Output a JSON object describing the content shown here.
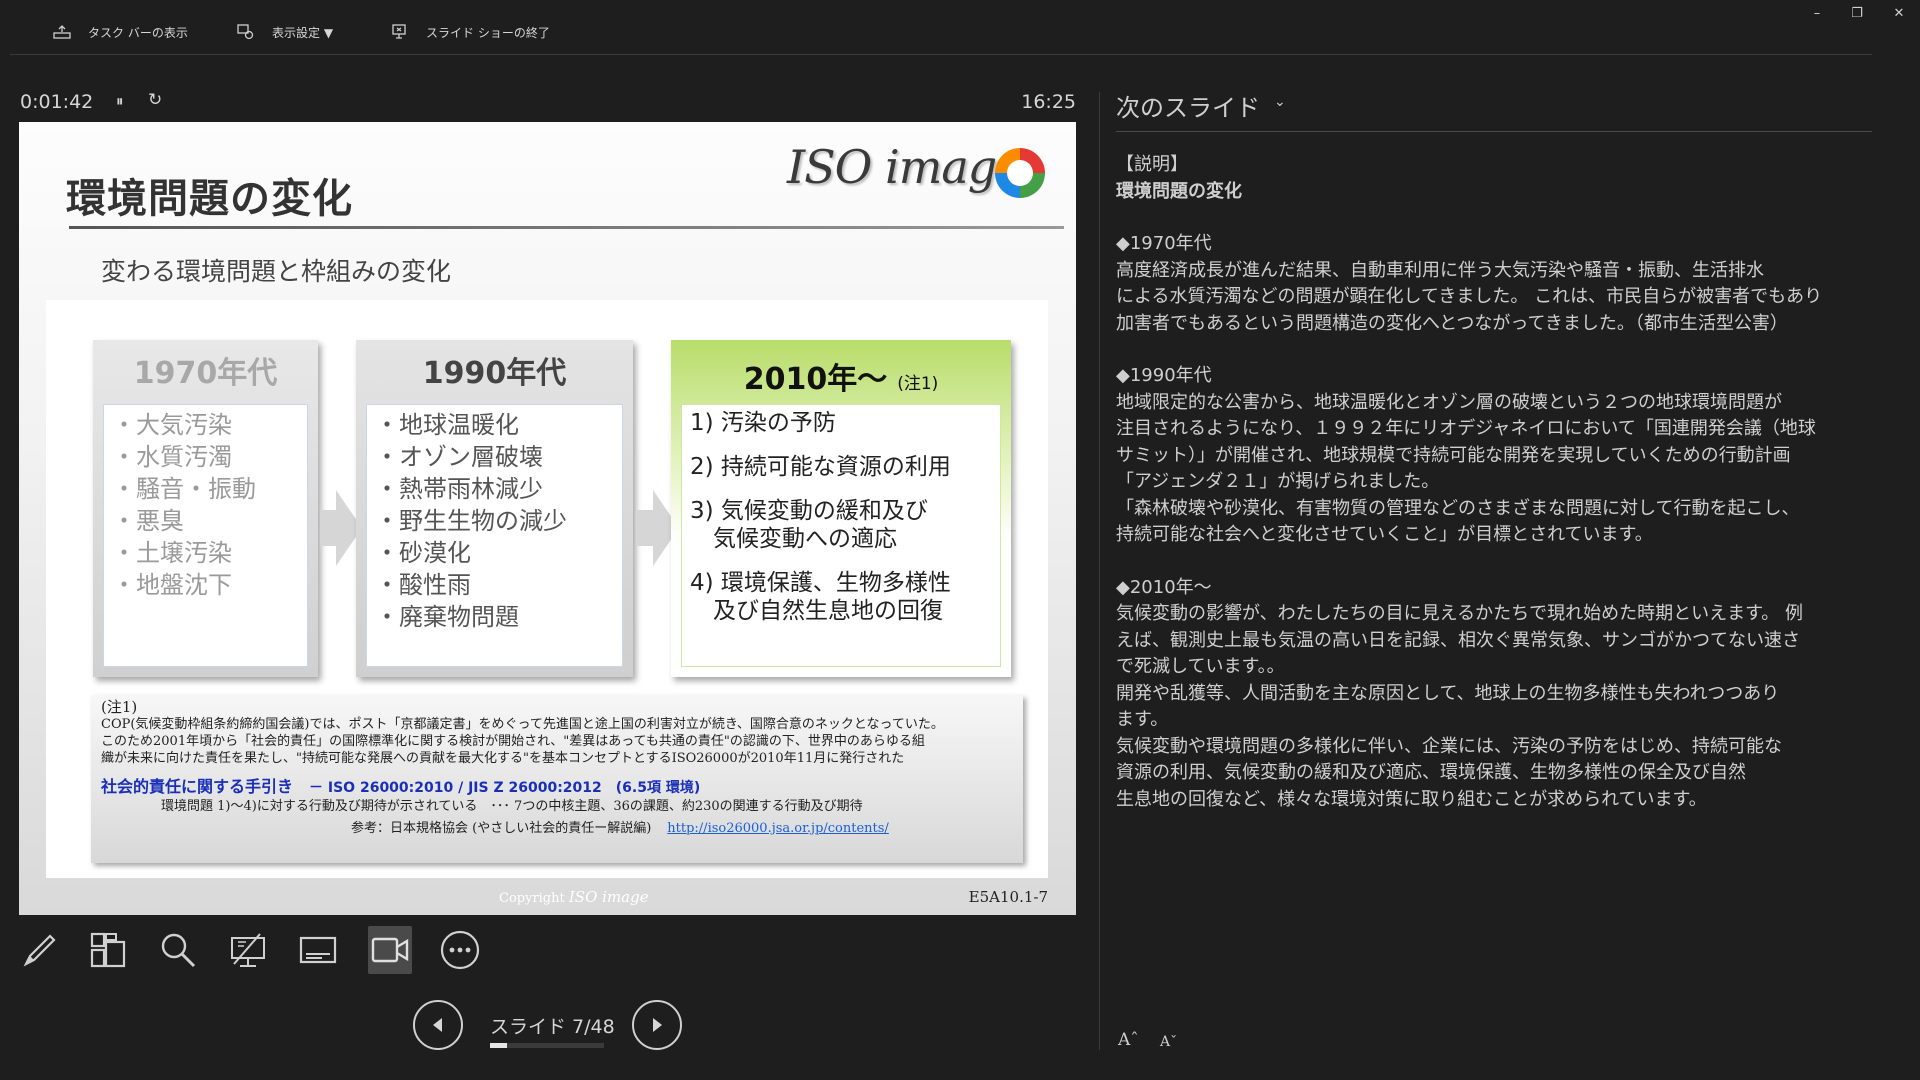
{
  "toolbar": {
    "taskbar_label": "タスク バーの表示",
    "display_label": "表示設定 ▼",
    "end_show_label": "スライド ショーの終了"
  },
  "window": {
    "minimize": "–",
    "restore": "❐",
    "close": "✕"
  },
  "timer": {
    "elapsed": "0:01:42",
    "pause_glyph": "⏸",
    "restart_glyph": "↻",
    "clock": "16:25"
  },
  "slide": {
    "title": "環境問題の変化",
    "subtitle": "変わる環境問題と枠組みの変化",
    "logo_text": "ISO image",
    "eras": [
      {
        "head": "1970年代",
        "items": [
          "・大気汚染",
          "・水質汚濁",
          "・騒音・振動",
          "・悪臭",
          "・土壌汚染",
          "・地盤沈下"
        ]
      },
      {
        "head": "1990年代",
        "items": [
          "・地球温暖化",
          "・オゾン層破壊",
          "・熱帯雨林減少",
          "・野生生物の減少",
          "・砂漠化",
          "・酸性雨",
          "・廃棄物問題"
        ]
      },
      {
        "head": "2010年～",
        "note": "(注1)",
        "items": [
          "1) 汚染の予防",
          "2) 持続可能な資源の利用",
          "3) 気候変動の緩和及び\n　気候変動への適応",
          "4) 環境保護、生物多様性\n　及び自然生息地の回復"
        ]
      }
    ],
    "notebox": {
      "head": "(注1)",
      "line1": "COP(気候変動枠組条約締約国会議)では、ポスト「京都議定書」をめぐって先進国と途上国の利害対立が続き、国際合意のネックとなっていた。",
      "line2": "このため2001年頃から「社会的責任」の国際標準化に関する検討が開始され、\"差異はあっても共通の責任\"の認識の下、世界中のあらゆる組",
      "line3": "織が未来に向けた責任を果たし、\"持続可能な発展への貢献を最大化する\"を基本コンセプトとするISO26000が2010年11月に発行された",
      "guide_title": "社会的責任に関する手引き",
      "guide_std": "－ ISO 26000:2010 / JIS Z 26000:2012　(6.5項 環境)",
      "guide_sub": "環境問題 1)～4)に対する行動及び期待が示されている　･･･ 7つの中核主題、36の課題、約230の関連する行動及び期待",
      "ref": "参考：日本規格協会 (やさしい社会的責任ー解説編)",
      "link": "http://iso26000.jsa.or.jp/contents/"
    },
    "copyright": "Copyright",
    "copyright_logo": "ISO image",
    "code": "E5A10.1-7"
  },
  "nav": {
    "slide_label": "スライド 7/48",
    "progress": 0.146
  },
  "notes": {
    "next_label": "次のスライド",
    "paragraphs": [
      "【説明】",
      "環境問題の変化",
      "",
      "◆1970年代",
      "高度経済成長が進んだ結果、自動車利用に伴う大気汚染や騒音・振動、生活排水\nによる水質汚濁などの問題が顕在化してきました。 これは、市民自らが被害者でもあり\n加害者でもあるという問題構造の変化へとつながってきました。（都市生活型公害）",
      "",
      "◆1990年代",
      "地域限定的な公害から、地球温暖化とオゾン層の破壊という２つの地球環境問題が\n注目されるようになり、１９９２年にリオデジャネイロにおいて「国連開発会議（地球\nサミット）」が開催され、地球規模で持続可能な開発を実現していくための行動計画\n「アジェンダ２１」が掲げられました。\n「森林破壊や砂漠化、有害物質の管理などのさまざまな問題に対して行動を起こし、\n持続可能な社会へと変化させていくこと」が目標とされています。",
      "",
      "◆2010年～",
      "気候変動の影響が、わたしたちの目に見えるかたちで現れ始めた時期といえます。 例\nえば、観測史上最も気温の高い日を記録、相次ぐ異常気象、サンゴがかつてない速さ\nで死滅しています。。\n開発や乱獲等、人間活動を主な原因として、地球上の生物多様性も失われつつあり\nます。\n気候変動や環境問題の多様化に伴い、企業には、汚染の予防をはじめ、持続可能な\n資源の利用、気候変動の緩和及び適応、環境保護、生物多様性の保全及び自然\n生息地の回復など、様々な環境対策に取り組むことが求められています。"
    ],
    "font_up": "Aˆ",
    "font_down": "Aˇ"
  },
  "icons": [
    "taskbar-icon",
    "display-settings-icon",
    "end-show-icon",
    "pen-icon",
    "all-slides-icon",
    "zoom-icon",
    "pointer-icon",
    "subtitles-icon",
    "camera-icon",
    "more-icon",
    "prev-icon",
    "next-icon"
  ]
}
